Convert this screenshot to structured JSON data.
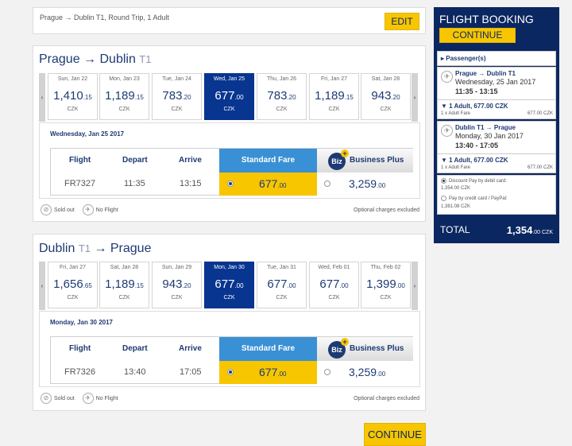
{
  "summary": {
    "text": "Prague → Dublin T1, Round Trip, 1 Adult",
    "edit_label": "EDIT"
  },
  "outbound": {
    "title_route": "Prague → Dublin",
    "title_terminal": "T1",
    "prev_arrow": "‹",
    "next_arrow": "›",
    "days": [
      {
        "label": "Sun, Jan 22",
        "int": "1,410",
        "dec": ".15",
        "cur": "CZK"
      },
      {
        "label": "Mon, Jan 23",
        "int": "1,189",
        "dec": ".15",
        "cur": "CZK"
      },
      {
        "label": "Tue, Jan 24",
        "int": "783",
        "dec": ".20",
        "cur": "CZK"
      },
      {
        "label": "Wed, Jan 25",
        "int": "677",
        "dec": ".00",
        "cur": "CZK"
      },
      {
        "label": "Thu, Jan 26",
        "int": "783",
        "dec": ".20",
        "cur": "CZK"
      },
      {
        "label": "Fri, Jan 27",
        "int": "1,189",
        "dec": ".15",
        "cur": "CZK"
      },
      {
        "label": "Sat, Jan 28",
        "int": "943",
        "dec": ".20",
        "cur": "CZK"
      }
    ],
    "selected_index": 3,
    "date_heading": "Wednesday, Jan 25 2017",
    "headers": {
      "flight": "Flight",
      "depart": "Depart",
      "arrive": "Arrive",
      "standard": "Standard Fare",
      "business": "Business Plus",
      "biz_logo": "Biz",
      "biz_plus": "+"
    },
    "row": {
      "flight": "FR7327",
      "depart": "11:35",
      "arrive": "13:15",
      "std_int": "677",
      "std_dec": ".00",
      "biz_int": "3,259",
      "biz_dec": ".00"
    },
    "legend": {
      "sold_out": "Sold out",
      "no_flight": "No Flight",
      "optional": "Optional charges excluded"
    }
  },
  "inbound": {
    "title_route": "Dublin",
    "title_terminal": "T1",
    "title_dest": "→ Prague",
    "prev_arrow": "‹",
    "next_arrow": "›",
    "days": [
      {
        "label": "Fri, Jan 27",
        "int": "1,656",
        "dec": ".65",
        "cur": "CZK"
      },
      {
        "label": "Sat, Jan 28",
        "int": "1,189",
        "dec": ".15",
        "cur": "CZK"
      },
      {
        "label": "Sun, Jan 29",
        "int": "943",
        "dec": ".20",
        "cur": "CZK"
      },
      {
        "label": "Mon, Jan 30",
        "int": "677",
        "dec": ".00",
        "cur": "CZK"
      },
      {
        "label": "Tue, Jan 31",
        "int": "677",
        "dec": ".00",
        "cur": "CZK"
      },
      {
        "label": "Wed, Feb 01",
        "int": "677",
        "dec": ".00",
        "cur": "CZK"
      },
      {
        "label": "Thu, Feb 02",
        "int": "1,399",
        "dec": ".00",
        "cur": "CZK"
      }
    ],
    "selected_index": 3,
    "date_heading": "Monday, Jan 30 2017",
    "headers": {
      "flight": "Flight",
      "depart": "Depart",
      "arrive": "Arrive",
      "standard": "Standard Fare",
      "business": "Business Plus",
      "biz_logo": "Biz",
      "biz_plus": "+"
    },
    "row": {
      "flight": "FR7326",
      "depart": "13:40",
      "arrive": "17:05",
      "std_int": "677",
      "std_dec": ".00",
      "biz_int": "3,259",
      "biz_dec": ".00"
    },
    "legend": {
      "sold_out": "Sold out",
      "no_flight": "No Flight",
      "optional": "Optional charges excluded"
    }
  },
  "continue_label": "CONTINUE",
  "sidebar": {
    "title": "FLIGHT BOOKING",
    "continue_label": "CONTINUE",
    "passengers": "▸ Passenger(s)",
    "legs": [
      {
        "route": "Prague → Dublin T1",
        "date": "Wednesday, 25 Jan 2017",
        "time": "11:35 - 13:15",
        "summary": "▼ 1 Adult, 677.00 CZK",
        "fare_label": "1 x Adult Fare",
        "fare_value": "677.00 CZK"
      },
      {
        "route": "Dublin T1 → Prague",
        "date": "Monday, 30 Jan 2017",
        "time": "13:40 - 17:05",
        "summary": "▼ 1 Adult, 677.00 CZK",
        "fare_label": "1 x Adult Fare",
        "fare_value": "677.00 CZK"
      }
    ],
    "payment": {
      "debit_label": "Discount Pay by debit card:",
      "debit_value": "1,354.00 CZK",
      "credit_label": "Pay by credit card / PayPal:",
      "credit_value": "1,381.08 CZK"
    },
    "total_label": "TOTAL",
    "total_int": "1,354",
    "total_dec": ".00 CZK"
  },
  "icons": {
    "plane": "✈",
    "sold_out": "⊘"
  },
  "colors": {
    "navy": "#0b2761",
    "accent_yellow": "#f7c600",
    "selected_day": "#073590",
    "standard_header": "#3a90d4"
  }
}
